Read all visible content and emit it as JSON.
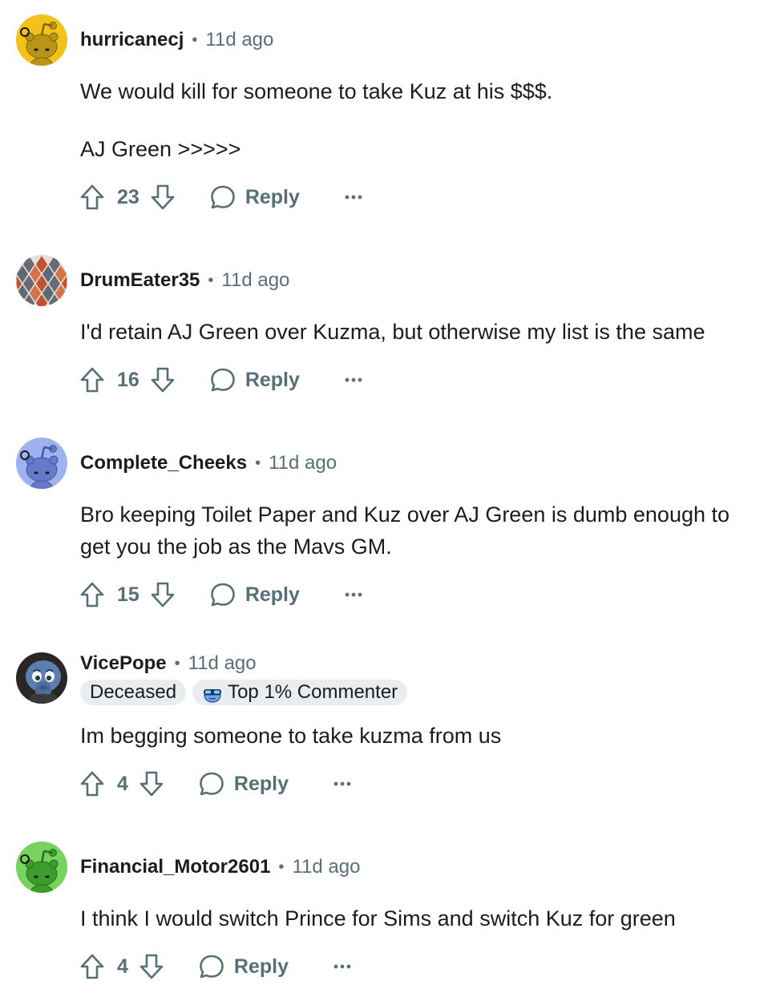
{
  "comments": [
    {
      "username": "hurricanecj",
      "time": "11d ago",
      "avatar": "snoo-avatar-icon",
      "avatar_color": "#f2c21b",
      "snoo_color": "#b99417",
      "paragraphs": [
        "We would kill for someone to take Kuz at his $$$.",
        "AJ Green >>>>>"
      ],
      "score": "23",
      "reply_label": "Reply"
    },
    {
      "username": "DrumEater35",
      "time": "11d ago",
      "avatar": "diamond-pattern-avatar-icon",
      "paragraphs": [
        "I'd retain AJ Green over Kuzma, but otherwise my list is the same"
      ],
      "score": "16",
      "reply_label": "Reply"
    },
    {
      "username": "Complete_Cheeks",
      "time": "11d ago",
      "avatar": "snoo-avatar-icon",
      "avatar_color": "#9eb2f0",
      "snoo_color": "#6578c9",
      "paragraphs": [
        "Bro keeping Toilet Paper and Kuz over AJ Green is dumb enough to get you the job as the Mavs GM."
      ],
      "score": "15",
      "reply_label": "Reply"
    },
    {
      "username": "VicePope",
      "time": "11d ago",
      "avatar": "cartoon-character-avatar-icon",
      "flairs": [
        "Deceased",
        "Top 1% Commenter"
      ],
      "flair_icon": "sunglasses-emoji-icon",
      "paragraphs": [
        "Im begging someone to take kuzma from us"
      ],
      "score": "4",
      "reply_label": "Reply"
    },
    {
      "username": "Financial_Motor2601",
      "time": "11d ago",
      "avatar": "snoo-avatar-icon",
      "avatar_color": "#77d25e",
      "snoo_color": "#3d9c2c",
      "paragraphs": [
        "I think I would switch Prince for Sims and switch Kuz for green"
      ],
      "score": "4",
      "reply_label": "Reply"
    }
  ],
  "icons": {
    "upvote": "upvote-arrow-icon",
    "downvote": "downvote-arrow-icon",
    "reply": "speech-bubble-icon",
    "more": "ellipsis-icon"
  },
  "colors": {
    "meta_text": "#576f76",
    "flair_bg": "#eaedef"
  }
}
